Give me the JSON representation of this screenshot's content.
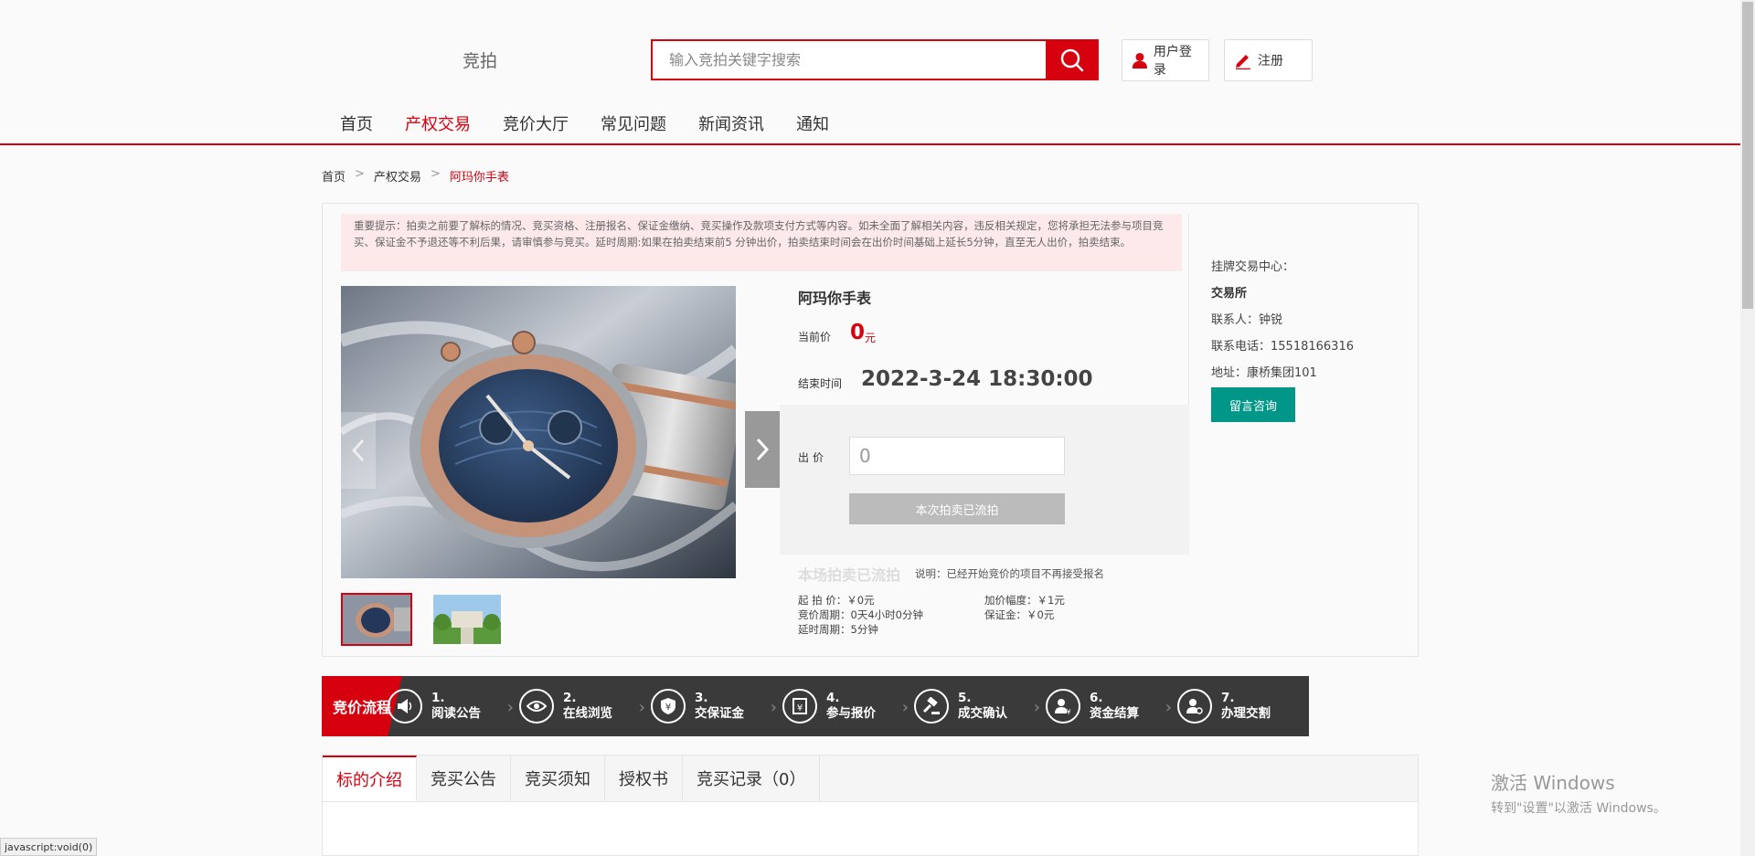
{
  "header": {
    "logo": "竞拍",
    "search_placeholder": "输入竞拍关键字搜索",
    "login": "用户登录",
    "register": "注册"
  },
  "nav": [
    "首页",
    "产权交易",
    "竞价大厅",
    "常见问题",
    "新闻资讯",
    "通知"
  ],
  "breadcrumb": {
    "home": "首页",
    "sep": ">",
    "section": "产权交易",
    "current": "阿玛你手表"
  },
  "notice": "重要提示：拍卖之前要了解标的情况、竞买资格、注册报名、保证金缴纳、竞买操作及款项支付方式等内容。如未全面了解相关内容，违反相关规定，您将承担无法参与项目竞买、保证金不予退还等不利后果，请审慎参与竞买。延时周期:如果在拍卖结束前5 分钟出价，拍卖结束时间会在出价时间基础上延长5分钟，直至无人出价，拍卖结束。",
  "item": {
    "title": "阿玛你手表",
    "price_label": "当前价",
    "price": "0",
    "price_unit": "元",
    "end_label": "结束时间",
    "end_time": "2022-3-24 18:30:00",
    "bid_label": "出价",
    "bid_value": "0",
    "bid_button": "本次拍卖已流拍",
    "status": "本场拍卖已流拍",
    "status_note": "说明：已经开始竞价的项目不再接受报名",
    "specs": {
      "start_price": "起 拍 价：￥0元",
      "increment": "加价幅度：￥1元",
      "cycle": "竞价周期：0天4小时0分钟",
      "deposit": "保证金：￥0元",
      "delay": "延时周期：5分钟"
    }
  },
  "sidebar": {
    "center_label": "挂牌交易中心：",
    "center_name": "交易所",
    "contact": "联系人：钟锐",
    "phone": "联系电话：15518166316",
    "address": "地址：康桥集团101",
    "consult_button": "留言咨询"
  },
  "flow": {
    "title": "竞价流程",
    "steps": [
      {
        "num": "1.",
        "label": "阅读公告",
        "icon": "megaphone-icon"
      },
      {
        "num": "2.",
        "label": "在线浏览",
        "icon": "eye-icon"
      },
      {
        "num": "3.",
        "label": "交保证金",
        "icon": "shield-yuan-icon"
      },
      {
        "num": "4.",
        "label": "参与报价",
        "icon": "bid-form-icon"
      },
      {
        "num": "5.",
        "label": "成交确认",
        "icon": "gavel-icon"
      },
      {
        "num": "6.",
        "label": "资金结算",
        "icon": "user-yuan-icon"
      },
      {
        "num": "7.",
        "label": "办理交割",
        "icon": "user-search-icon"
      }
    ]
  },
  "tabs": [
    "标的介绍",
    "竞买公告",
    "竞买须知",
    "授权书",
    "竞买记录（0）"
  ],
  "watermark": {
    "line1": "激活 Windows",
    "line2": "转到\"设置\"以激活 Windows。"
  },
  "status_bar": "javascript:void(0)",
  "colors": {
    "accent": "#d7000f",
    "teal": "#009688",
    "dark": "#3a3a3a"
  }
}
